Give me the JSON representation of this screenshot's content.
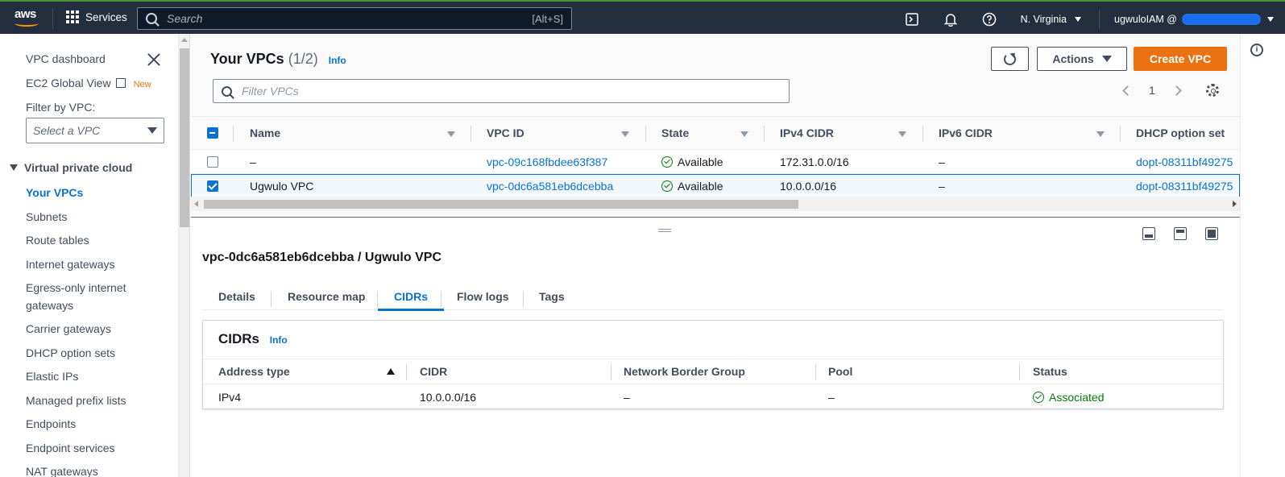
{
  "topnav": {
    "logo_text": "aws",
    "services_label": "Services",
    "search_placeholder": "Search",
    "search_shortcut": "[Alt+S]",
    "region": "N. Virginia",
    "account": "ugwuloIAM @"
  },
  "sidebar": {
    "dashboard": "VPC dashboard",
    "global_view": "EC2 Global View",
    "new_badge": "New",
    "filter_label": "Filter by VPC:",
    "filter_placeholder": "Select a VPC",
    "section": "Virtual private cloud",
    "items": [
      {
        "label": "Your VPCs"
      },
      {
        "label": "Subnets"
      },
      {
        "label": "Route tables"
      },
      {
        "label": "Internet gateways"
      },
      {
        "label": "Egress-only internet"
      },
      {
        "label": "gateways"
      },
      {
        "label": "Carrier gateways"
      },
      {
        "label": "DHCP option sets"
      },
      {
        "label": "Elastic IPs"
      },
      {
        "label": "Managed prefix lists"
      },
      {
        "label": "Endpoints"
      },
      {
        "label": "Endpoint services"
      },
      {
        "label": "NAT gateways"
      }
    ]
  },
  "header": {
    "title": "Your VPCs",
    "count": "(1/2)",
    "info": "Info",
    "actions_label": "Actions",
    "create_label": "Create VPC",
    "filter_placeholder": "Filter VPCs",
    "page": "1"
  },
  "vpc_table": {
    "columns": [
      "Name",
      "VPC ID",
      "State",
      "IPv4 CIDR",
      "IPv6 CIDR",
      "DHCP option set"
    ],
    "rows": [
      {
        "name": "–",
        "vpc_id": "vpc-09c168fbdee63f387",
        "state": "Available",
        "ipv4": "172.31.0.0/16",
        "ipv6": "–",
        "dhcp": "dopt-08311bf49275",
        "selected": false
      },
      {
        "name": "Ugwulo VPC",
        "vpc_id": "vpc-0dc6a581eb6dcebba",
        "state": "Available",
        "ipv4": "10.0.0.0/16",
        "ipv6": "–",
        "dhcp": "dopt-08311bf49275",
        "selected": true
      }
    ]
  },
  "details": {
    "title": "vpc-0dc6a581eb6dcebba / Ugwulo VPC",
    "tabs": [
      "Details",
      "Resource map",
      "CIDRs",
      "Flow logs",
      "Tags"
    ],
    "active_tab": "CIDRs",
    "cidrs": {
      "title": "CIDRs",
      "info": "Info",
      "columns": [
        "Address type",
        "CIDR",
        "Network Border Group",
        "Pool",
        "Status"
      ],
      "rows": [
        {
          "address_type": "IPv4",
          "cidr": "10.0.0.0/16",
          "network_border_group": "–",
          "pool": "–",
          "status": "Associated"
        }
      ]
    }
  },
  "colors": {
    "nav_bg": "#232f3e",
    "primary": "#ec7211",
    "link": "#0972d3",
    "success": "#037f0c"
  }
}
